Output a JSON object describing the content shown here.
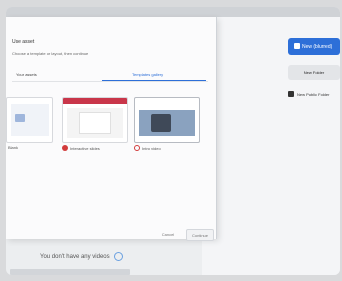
{
  "header": {
    "new_button_label": "New (blurred)"
  },
  "right_panel": {
    "new_folder_label": "New Folder",
    "public_link_label": "New Public Folder"
  },
  "dialog": {
    "title": "Use asset",
    "subtitle": "Choose a template or layout, then continue",
    "tabs": [
      {
        "label": "Your assets"
      },
      {
        "label": "Templates gallery"
      }
    ],
    "captions": [
      "Blank",
      "Interactive slides",
      "Intro video"
    ],
    "buttons": {
      "cancel": "Cancel",
      "ok": "Continue"
    }
  },
  "empty_state": {
    "message": "You don't have any videos"
  },
  "colors": {
    "accent": "#2d6fd8",
    "red": "#d23b3b"
  }
}
